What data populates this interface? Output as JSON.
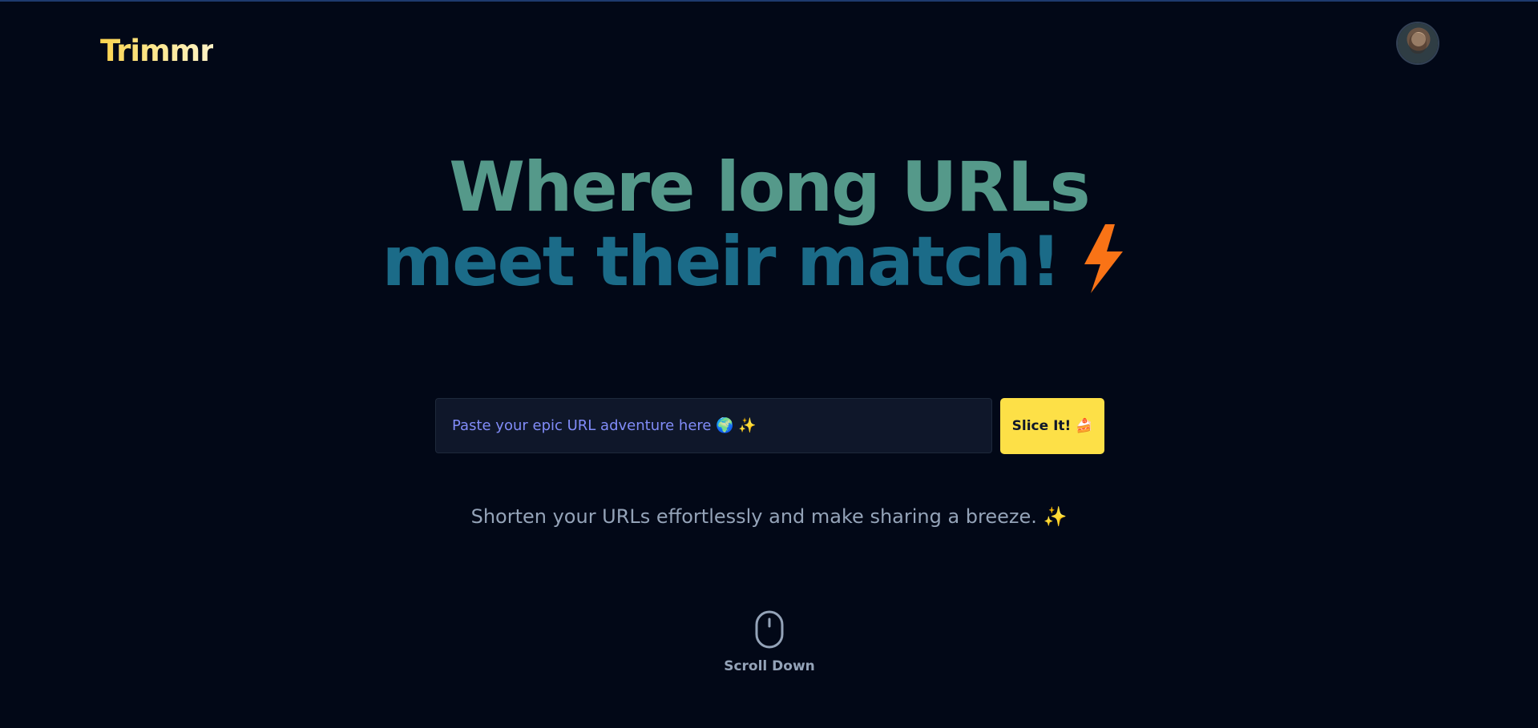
{
  "header": {
    "logo": "Trimmr",
    "avatar_icon": "user-avatar"
  },
  "hero": {
    "line1": "Where long URLs",
    "line2": "meet their match!",
    "bolt_icon": "lightning-bolt-icon",
    "line1_color": "#55998a",
    "line2_color": "#1b6b88",
    "bolt_color": "#f97316"
  },
  "form": {
    "url_placeholder": "Paste your epic URL adventure here 🌍 ✨",
    "url_value": "",
    "submit_label": "Slice It! 🍰"
  },
  "tagline": "Shorten your URLs effortlessly and make sharing a breeze. ✨",
  "scroll": {
    "icon": "mouse-icon",
    "label": "Scroll Down"
  },
  "colors": {
    "background": "#020817",
    "accent_yellow": "#fde047",
    "placeholder": "#818cf8",
    "muted_text": "#94a3b8"
  }
}
